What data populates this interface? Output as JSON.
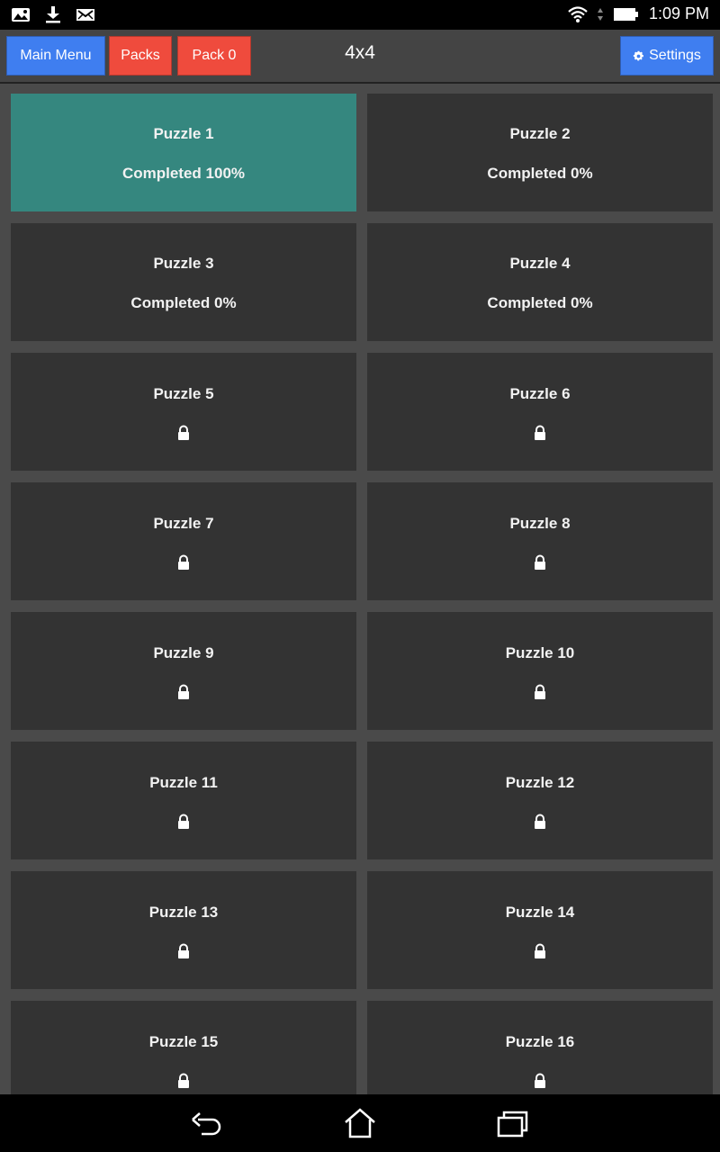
{
  "status_bar": {
    "time": "1:09 PM",
    "left_icons": [
      "image-icon",
      "download-icon",
      "mail-icon"
    ],
    "right_icons": [
      "wifi-icon",
      "signal-icon",
      "battery-icon"
    ]
  },
  "toolbar": {
    "main_menu_label": "Main Menu",
    "packs_label": "Packs",
    "pack_label": "Pack 0",
    "title": "4x4",
    "settings_label": "Settings",
    "settings_icon": "gear-icon"
  },
  "puzzles": [
    {
      "name": "Puzzle 1",
      "status": "Completed 100%",
      "locked": false
    },
    {
      "name": "Puzzle 2",
      "status": "Completed 0%",
      "locked": false
    },
    {
      "name": "Puzzle 3",
      "status": "Completed 0%",
      "locked": false
    },
    {
      "name": "Puzzle 4",
      "status": "Completed 0%",
      "locked": false
    },
    {
      "name": "Puzzle 5",
      "locked": true
    },
    {
      "name": "Puzzle 6",
      "locked": true
    },
    {
      "name": "Puzzle 7",
      "locked": true
    },
    {
      "name": "Puzzle 8",
      "locked": true
    },
    {
      "name": "Puzzle 9",
      "locked": true
    },
    {
      "name": "Puzzle 10",
      "locked": true
    },
    {
      "name": "Puzzle 11",
      "locked": true
    },
    {
      "name": "Puzzle 12",
      "locked": true
    },
    {
      "name": "Puzzle 13",
      "locked": true
    },
    {
      "name": "Puzzle 14",
      "locked": true
    },
    {
      "name": "Puzzle 15",
      "locked": true
    },
    {
      "name": "Puzzle 16",
      "locked": true
    }
  ],
  "colors": {
    "blue_button": "#3f7ef0",
    "red_button": "#ef4b3d",
    "completed_tile": "#35877f",
    "tile": "#333333",
    "background": "#4a4a4a",
    "toolbar": "#444444"
  },
  "nav_bar": {
    "icons": [
      "back-icon",
      "home-icon",
      "recent-apps-icon"
    ]
  }
}
